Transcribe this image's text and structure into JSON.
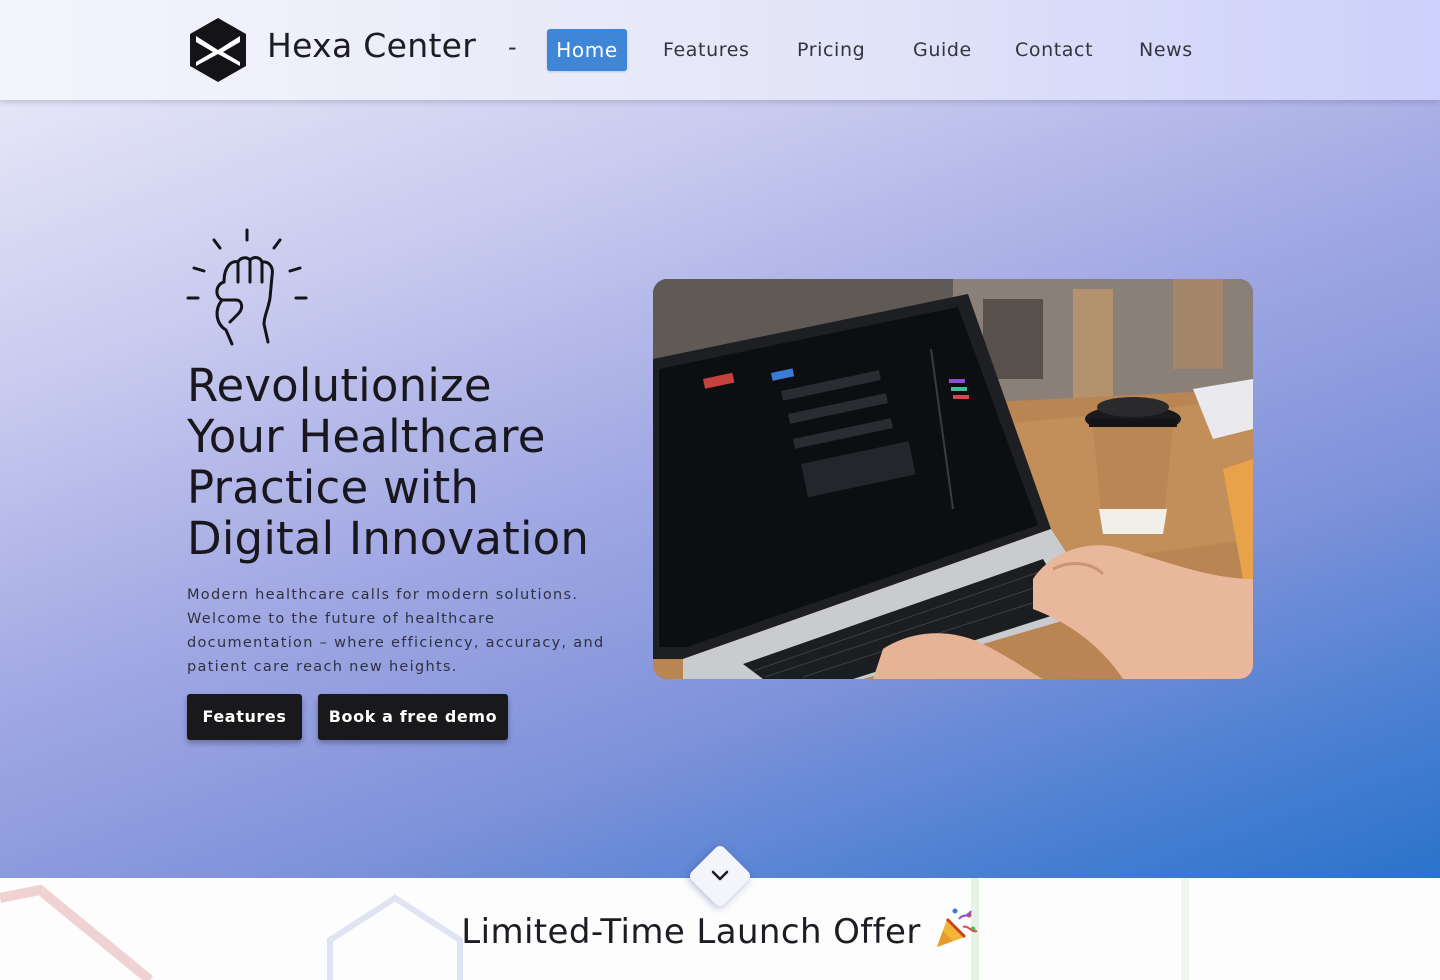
{
  "header": {
    "brand": "Hexa Center",
    "separator": "-",
    "nav": [
      {
        "label": "Home",
        "active": true
      },
      {
        "label": "Features",
        "active": false
      },
      {
        "label": "Pricing",
        "active": false
      },
      {
        "label": "Guide",
        "active": false
      },
      {
        "label": "Contact",
        "active": false
      },
      {
        "label": "News",
        "active": false
      }
    ]
  },
  "hero": {
    "title_lines": [
      "Revolutionize",
      "Your Healthcare",
      "Practice with",
      "Digital Innovation"
    ],
    "description_lines": [
      "Modern healthcare calls for modern solutions.",
      "Welcome to the future of healthcare",
      "documentation – where efficiency, accuracy, and",
      "patient care reach new heights."
    ],
    "buttons": {
      "features": "Features",
      "demo": "Book a free demo"
    },
    "image_icon": "raised-fist-icon",
    "photo_icon": "laptop-photo"
  },
  "offer": {
    "title": "Limited-Time Launch Offer",
    "icon": "party-popper-icon"
  },
  "colors": {
    "accent": "#3f87d6",
    "button_dark": "#19191c",
    "hero_gradient_end": "#2a73cb"
  }
}
